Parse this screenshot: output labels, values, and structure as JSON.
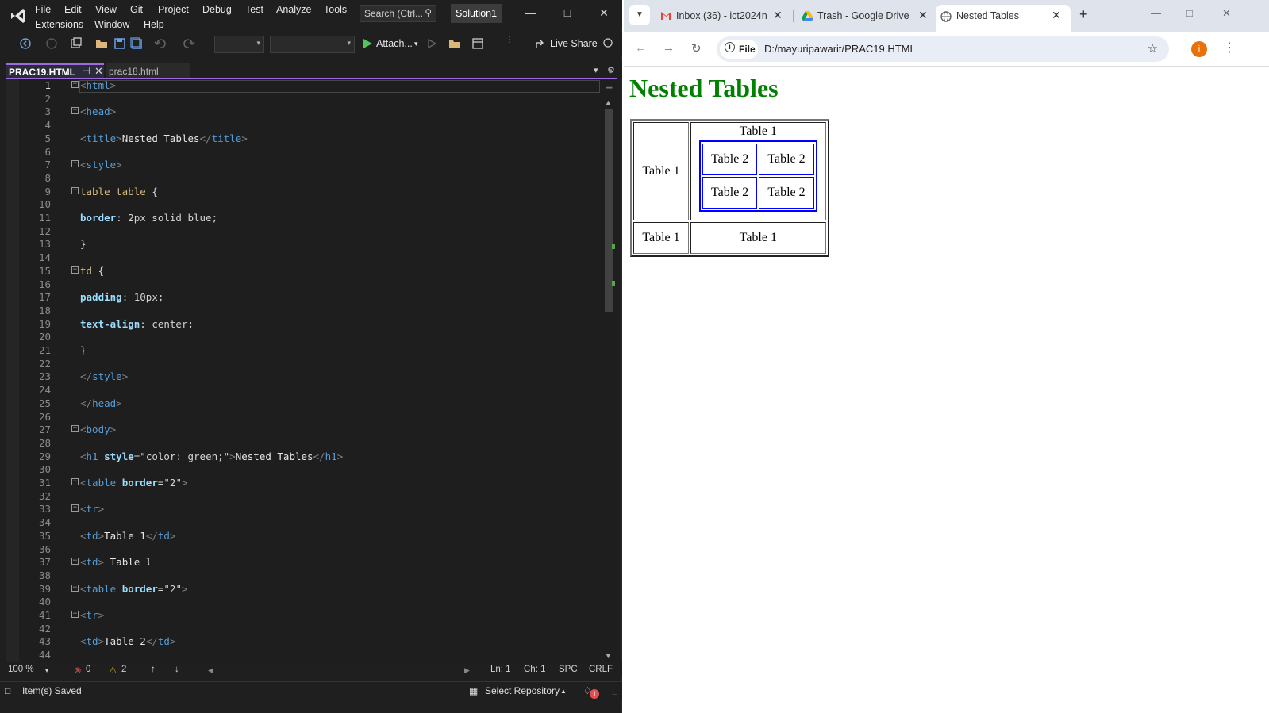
{
  "vs": {
    "menu": [
      "File",
      "Edit",
      "View",
      "Git",
      "Project",
      "Debug",
      "Test",
      "Analyze",
      "Tools",
      "Extensions",
      "Window",
      "Help"
    ],
    "search_placeholder": "Search (Ctrl...",
    "solution": "Solution1",
    "toolbar": {
      "attach_label": "Attach...",
      "live_share_label": "Live Share"
    },
    "tabs": [
      {
        "label": "PRAC19.HTML",
        "active": true
      },
      {
        "label": "prac18.html",
        "active": false
      }
    ],
    "code_lines": [
      "<html>",
      "",
      "<head>",
      "",
      "<title>Nested Tables</title>",
      "",
      "<style>",
      "",
      "table table {",
      "",
      "border: 2px solid blue;",
      "",
      "}",
      "",
      "td {",
      "",
      "padding: 10px;",
      "",
      "text-align: center;",
      "",
      "}",
      "",
      "</style>",
      "",
      "</head>",
      "",
      "<body>",
      "",
      "<h1 style=\"color: green;\">Nested Tables</h1>",
      "",
      "<table border=\"2\">",
      "",
      "<tr>",
      "",
      "<td>Table 1</td>",
      "",
      "<td> Table l",
      "",
      "<table border=\"2\">",
      "",
      "<tr>",
      "",
      "<td>Table 2</td>",
      ""
    ],
    "status": {
      "zoom": "100 %",
      "errors": "0",
      "warnings": "2",
      "line": "Ln: 1",
      "col": "Ch: 1",
      "spacing": "SPC",
      "eol": "CRLF"
    },
    "bottom": {
      "message": "Item(s) Saved",
      "repo": "Select Repository",
      "notifications": "1"
    }
  },
  "chrome": {
    "tabs": [
      {
        "title": "Inbox (36) - ict2024n",
        "icon": "gmail-icon"
      },
      {
        "title": "Trash - Google Drive",
        "icon": "drive-icon"
      },
      {
        "title": "Nested Tables",
        "icon": "globe-icon",
        "active": true
      }
    ],
    "address": {
      "scheme_label": "File",
      "url": "D:/mayuripawarit/PRAC19.HTML"
    },
    "profile_initial": "i",
    "page": {
      "heading": "Nested Tables",
      "outer": {
        "r1c1": "Table 1",
        "r1c2": "Table 1",
        "r2c1": "Table 1",
        "r2c2": "Table 1"
      },
      "inner": [
        "Table 2",
        "Table 2",
        "Table 2",
        "Table 2"
      ]
    }
  }
}
